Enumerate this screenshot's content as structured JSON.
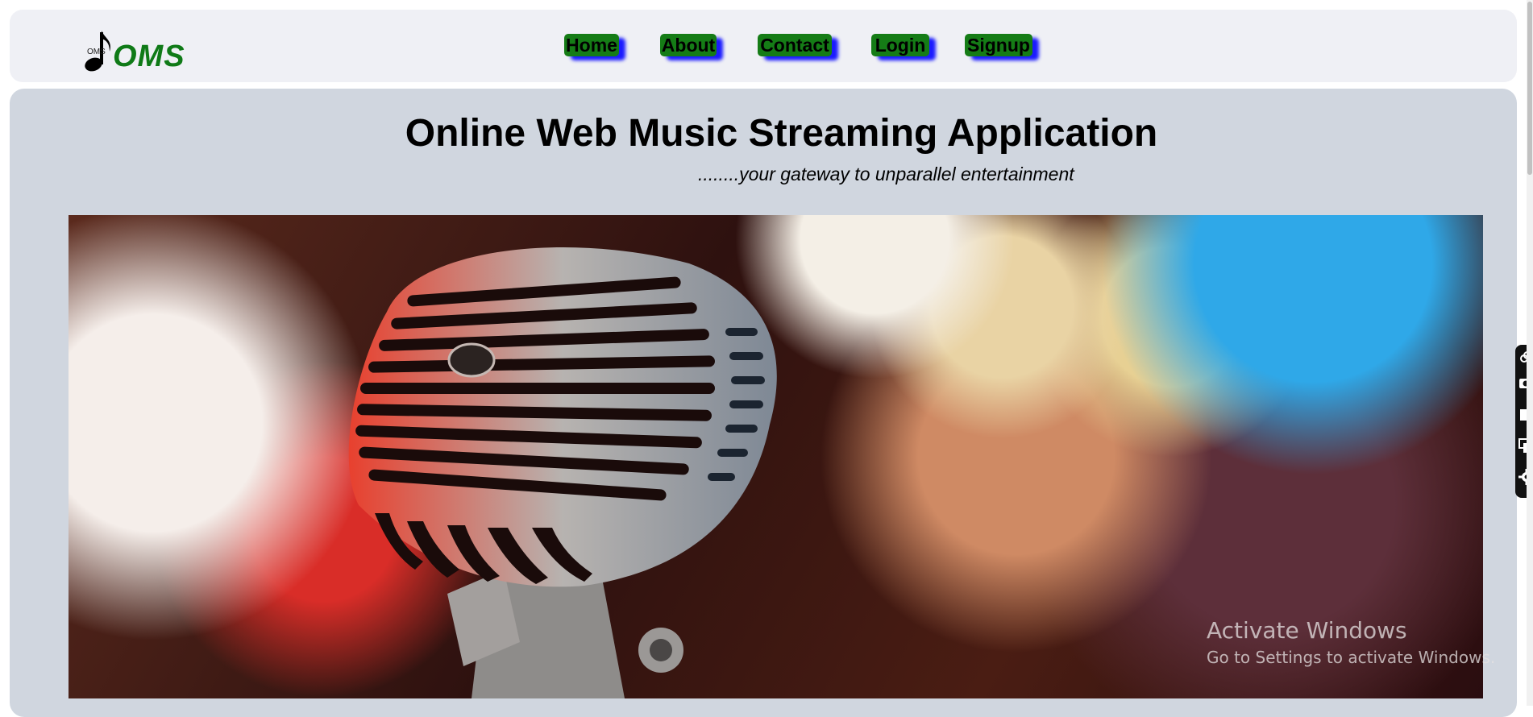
{
  "logo": {
    "small_text": "OMS",
    "text": "OMS",
    "icon": "music-note-icon",
    "color": "#0f7a17"
  },
  "nav": {
    "items": [
      {
        "label": "Home"
      },
      {
        "label": "About"
      },
      {
        "label": "Contact"
      },
      {
        "label": "Login"
      },
      {
        "label": "Signup"
      }
    ],
    "button_color": "#157c16",
    "shadow_color": "#1b1bff"
  },
  "hero": {
    "title": "Online Web Music Streaming Application",
    "tagline": "........your gateway to unparallel entertainment",
    "image": "vintage-microphone-image"
  },
  "watermark": {
    "line1": "Activate Windows",
    "line2": "Go to Settings to activate Windows."
  },
  "side_dock": {
    "icons": [
      "link-icon",
      "camera-icon",
      "square-icon",
      "copy-icon",
      "gear-icon"
    ]
  }
}
